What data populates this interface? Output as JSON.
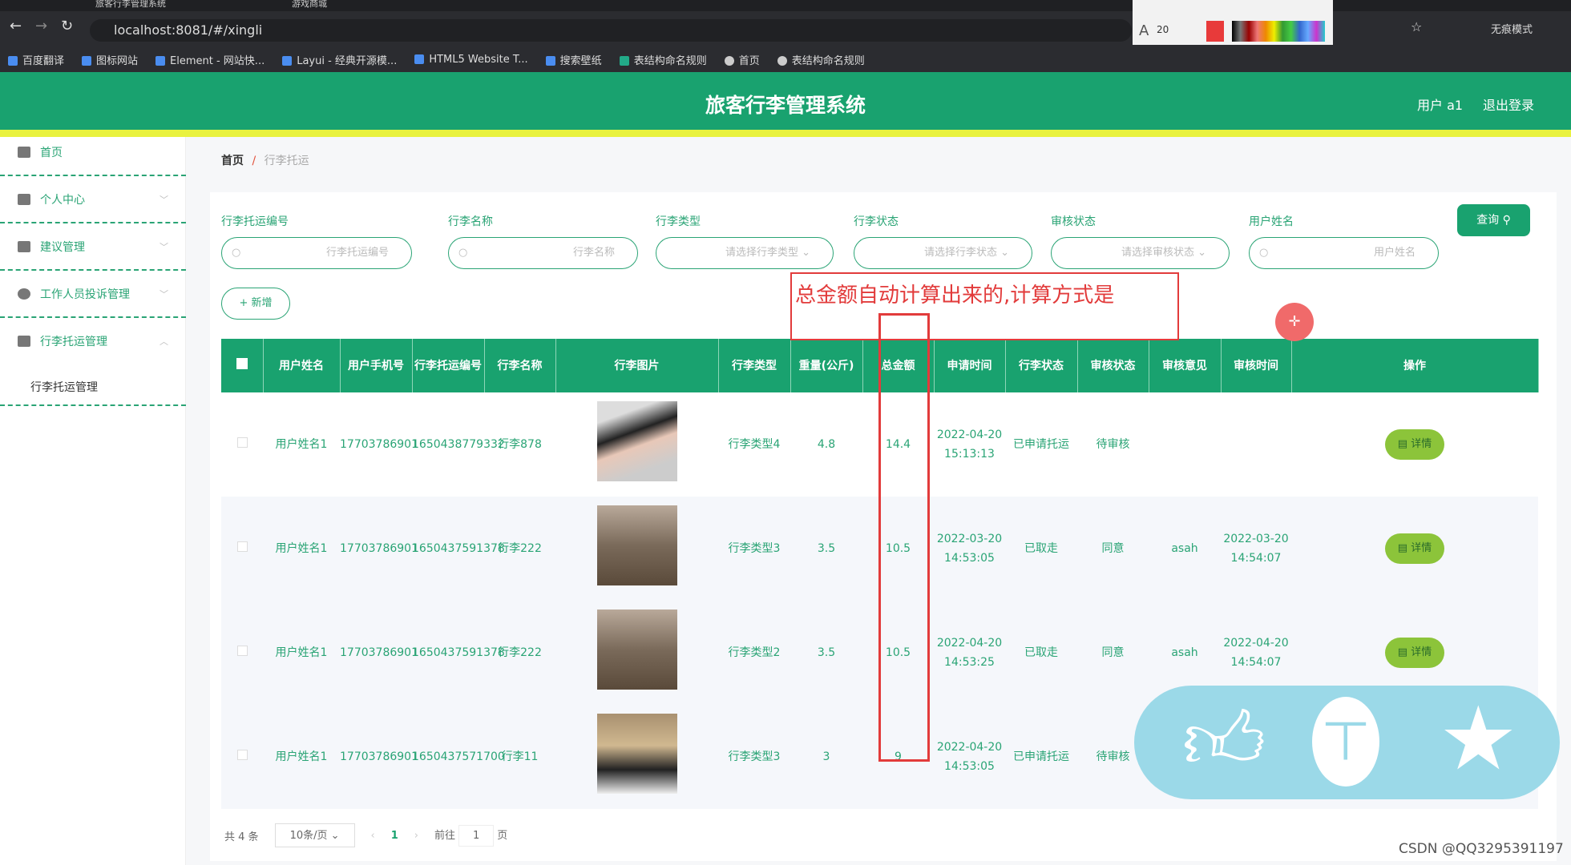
{
  "browser": {
    "tabs": [
      "旅客行李管理系统",
      "游戏商城"
    ],
    "url": "localhost:8081/#/xingli",
    "annotation_tool": {
      "font_size": "20"
    },
    "incognito": "无痕模式",
    "bookmarks": [
      "百度翻译",
      "图标网站",
      "Element - 网站快...",
      "Layui - 经典开源模...",
      "HTML5 Website T...",
      "搜索壁纸",
      "表结构命名规则",
      "首页",
      "表结构命名规则"
    ]
  },
  "header": {
    "title": "旅客行李管理系统",
    "user": "用户 a1",
    "logout": "退出登录",
    "accent": "#19a26f"
  },
  "sidebar": {
    "items": [
      {
        "label": "首页",
        "icon": "home-icon"
      },
      {
        "label": "个人中心",
        "icon": "user-icon"
      },
      {
        "label": "建议管理",
        "icon": "ticket-icon"
      },
      {
        "label": "工作人员投诉管理",
        "icon": "compass-icon"
      },
      {
        "label": "行李托运管理",
        "icon": "chart-icon"
      }
    ],
    "sub": "行李托运管理"
  },
  "breadcrumb": {
    "home": "首页",
    "sep": "/",
    "current": "行李托运"
  },
  "filters": [
    {
      "label": "行李托运编号",
      "placeholder": "行李托运编号"
    },
    {
      "label": "行李名称",
      "placeholder": "行李名称"
    },
    {
      "label": "行李类型",
      "placeholder": "请选择行李类型"
    },
    {
      "label": "行李状态",
      "placeholder": "请选择行李状态"
    },
    {
      "label": "审核状态",
      "placeholder": "请选择审核状态"
    },
    {
      "label": "用户姓名",
      "placeholder": "用户姓名"
    }
  ],
  "query": "查询",
  "add": "+ 新增",
  "table": {
    "headers": [
      "用户姓名",
      "用户手机号",
      "行李托运编号",
      "行李名称",
      "行李图片",
      "行李类型",
      "重量(公斤)",
      "总金额",
      "申请时间",
      "行李状态",
      "审核状态",
      "审核意见",
      "审核时间",
      "操作"
    ],
    "rows": [
      [
        "用户姓名1",
        "17703786901",
        "1650438779332",
        "行李878",
        "",
        "行李类型4",
        "4.8",
        "14.4",
        "2022-04-20 15:13:13",
        "已申请托运",
        "待审核",
        "",
        ""
      ],
      [
        "用户姓名1",
        "17703786901",
        "1650437591378",
        "行李222",
        "",
        "行李类型3",
        "3.5",
        "10.5",
        "2022-03-20 14:53:05",
        "已取走",
        "同意",
        "asah",
        "2022-03-20 14:54:07"
      ],
      [
        "用户姓名1",
        "17703786901",
        "1650437591378",
        "行李222",
        "",
        "行李类型2",
        "3.5",
        "10.5",
        "2022-04-20 14:53:25",
        "已取走",
        "同意",
        "asah",
        "2022-04-20 14:54:07"
      ],
      [
        "用户姓名1",
        "17703786901",
        "1650437571700",
        "行李11",
        "",
        "行李类型3",
        "3",
        "9",
        "2022-04-20 14:53:05",
        "已申请托运",
        "待审核",
        "",
        ""
      ]
    ],
    "detail": "详情"
  },
  "pagination": {
    "total": "共 4 条",
    "page_size": "10条/页",
    "current": "1",
    "goto": "前往",
    "goto_value": "1",
    "page_unit": "页"
  },
  "annotation": {
    "text": "总金额自动计算出来的,计算方式是"
  },
  "watermark": "CSDN @QQ3295391197"
}
